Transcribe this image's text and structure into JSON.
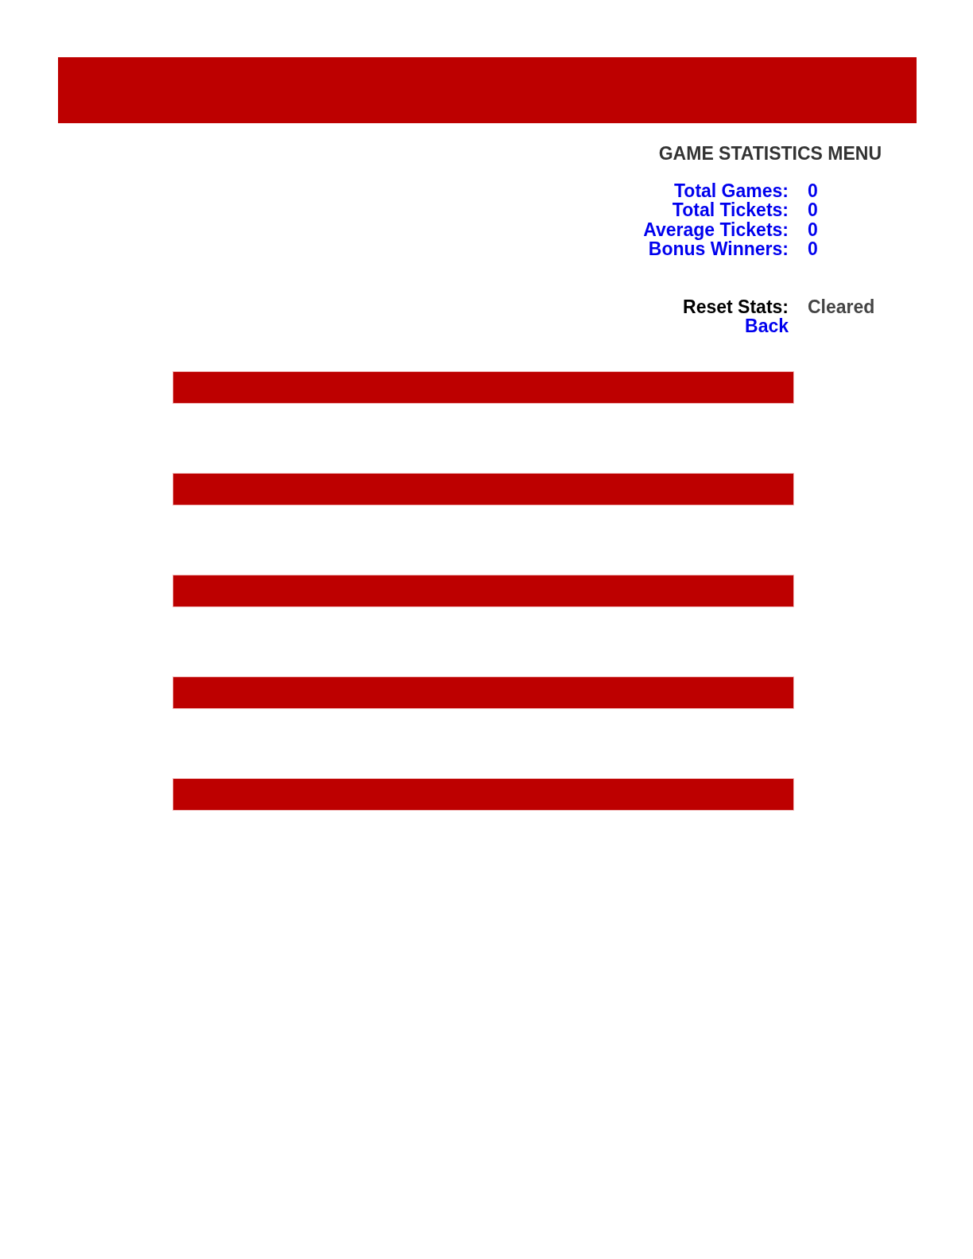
{
  "title": "GAME STATISTICS MENU",
  "stats": [
    {
      "label": "Total Games:",
      "value": "0"
    },
    {
      "label": "Total Tickets:",
      "value": "0"
    },
    {
      "label": "Average Tickets:",
      "value": "0"
    },
    {
      "label": "Bonus Winners:",
      "value": "0"
    }
  ],
  "reset": {
    "label": "Reset Stats:",
    "value": "Cleared"
  },
  "back_link": "Back"
}
